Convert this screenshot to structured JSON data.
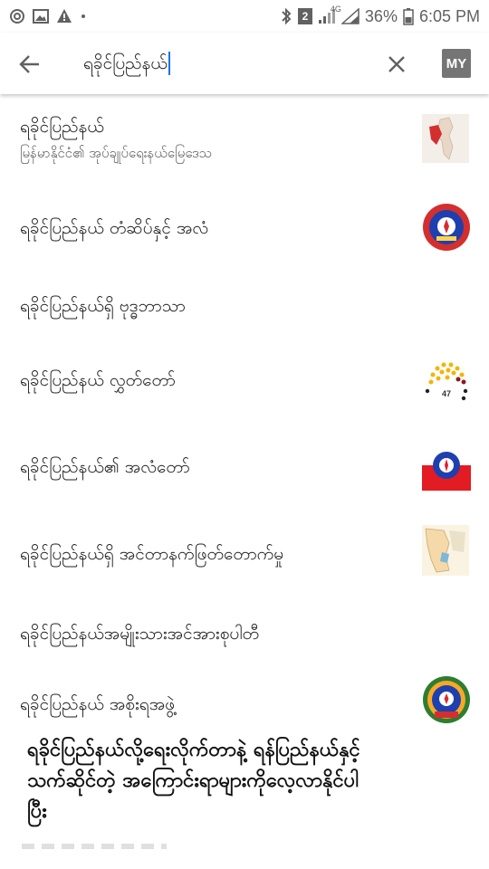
{
  "status_bar": {
    "icons_left": [
      "at-icon",
      "image-icon",
      "warning-icon",
      "dot-icon"
    ],
    "icons_right": [
      "bluetooth-icon",
      "sim-2-icon",
      "signal-icon",
      "4g-signal-icon",
      "battery-icon"
    ],
    "sim_label": "2",
    "network_label": "4G",
    "battery_percent": "36%",
    "time": "6:05 PM"
  },
  "search": {
    "query": "ရခိုင်ပြည်နယ်",
    "back_icon": "arrow-back-icon",
    "clear_icon": "close-icon",
    "language_badge": "MY"
  },
  "suggestions": [
    {
      "title": "ရခိုင်ပြည်နယ်",
      "subtitle": "မြန်မာနိုင်ငံ၏ အုပ်ချုပ်ရေးနယ်မြေဒေသ",
      "thumbnail": "map-thumbnail"
    },
    {
      "title": "ရခိုင်ပြည်နယ် တံဆိပ်နှင့် အလံ",
      "subtitle": "",
      "thumbnail": "emblem-thumbnail"
    },
    {
      "title": "ရခိုင်ပြည်နယ်ရှိ ဗုဒ္ဓဘာသာ",
      "subtitle": "",
      "thumbnail": ""
    },
    {
      "title": "ရခိုင်ပြည်နယ် လွှတ်တော်",
      "subtitle": "",
      "thumbnail": "parliament-seats-thumbnail",
      "thumbnail_label": "47"
    },
    {
      "title": "ရခိုင်ပြည်နယ်၏ အလံတော်",
      "subtitle": "",
      "thumbnail": "flag-thumbnail"
    },
    {
      "title": "ရခိုင်ပြည်နယ်ရှိ အင်တာနက်ဖြတ်တောက်မှု",
      "subtitle": "",
      "thumbnail": "region-map-thumbnail"
    },
    {
      "title": "ရခိုင်ပြည်နယ်အမျိုးသားအင်အားစုပါတီ",
      "subtitle": "",
      "thumbnail": ""
    },
    {
      "title": "ရခိုင်ပြည်နယ် အစိုးရအဖွဲ့",
      "subtitle": "",
      "thumbnail": "government-seal-thumbnail"
    }
  ],
  "caption": {
    "lines": [
      "ရခိုင်ပြည်နယ်လို့ရေးလိုက်တာနဲ့ ရန်ပြည်နယ်နှင့်",
      "သက်ဆိုင်တဲ့ အကြောင်းရာများကိုလေ့လာနိုင်ပါ",
      "ပြီး"
    ]
  },
  "colors": {
    "accent_cursor": "#1a73e8",
    "badge_bg": "#757575",
    "emblem_red": "#d32f2f",
    "emblem_blue": "#1e40af",
    "flag_red": "#e31b23"
  }
}
